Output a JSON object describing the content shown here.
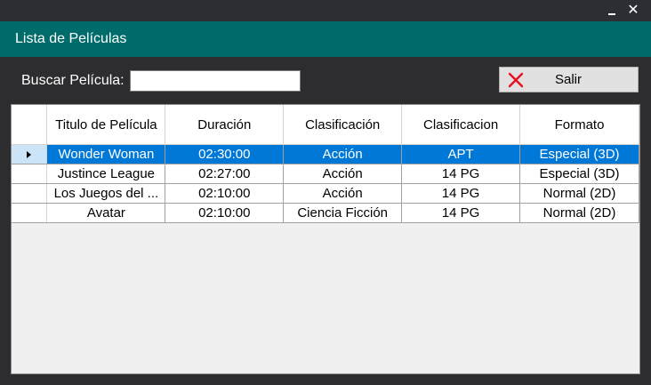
{
  "window": {
    "minimize_glyph": "_",
    "close_glyph": "✕"
  },
  "header": {
    "title": "Lista de Películas"
  },
  "search": {
    "label": "Buscar Película:",
    "value": "",
    "placeholder": ""
  },
  "exit_button": {
    "label": "Salir",
    "icon": "red-x-icon",
    "icon_color": "#e81123"
  },
  "grid": {
    "columns": [
      "Titulo de Película",
      "Duración",
      "Clasificación",
      "Clasificacion",
      "Formato"
    ],
    "rows": [
      [
        "Wonder Woman",
        "02:30:00",
        "Acción",
        "APT",
        "Especial (3D)"
      ],
      [
        "Justince League",
        "02:27:00",
        "Acción",
        "14 PG",
        "Especial (3D)"
      ],
      [
        "Los Juegos del ...",
        "02:10:00",
        "Acción",
        "14 PG",
        "Normal (2D)"
      ],
      [
        "Avatar",
        "02:10:00",
        "Ciencia Ficción",
        "14 PG",
        "Normal (2D)"
      ]
    ],
    "selected_row": 0,
    "selection_color": "#0078d7"
  },
  "colors": {
    "header_bg": "#006b6b",
    "window_bg": "#2d2d30"
  }
}
